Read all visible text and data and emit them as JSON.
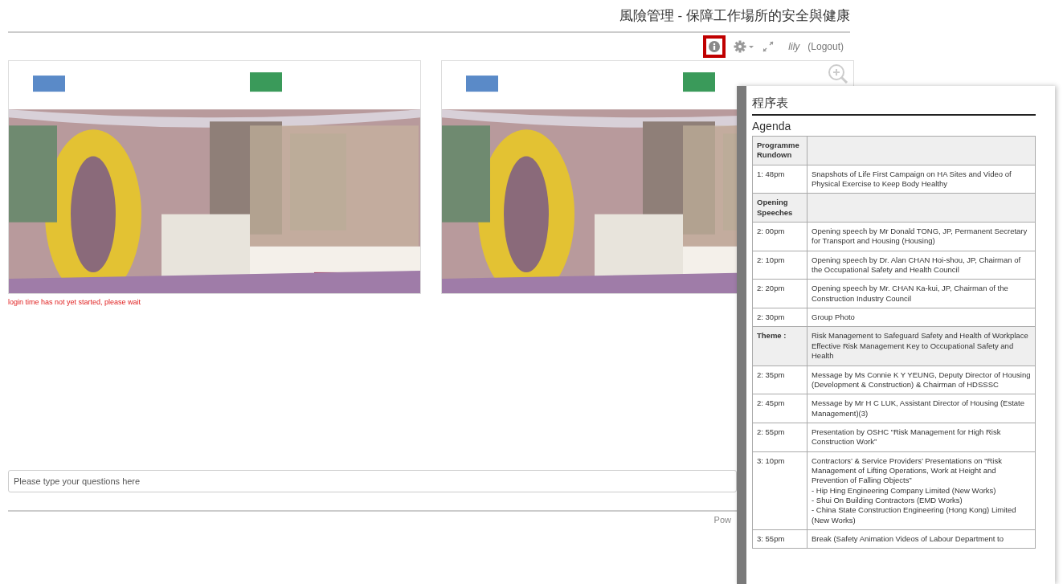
{
  "page_title": "風險管理 - 保障工作場所的安全與健康",
  "toolbar": {
    "info_highlighted": true,
    "user": "lily",
    "logout": "(Logout)"
  },
  "status_message": "login time has not yet started, please wait",
  "question_field": {
    "placeholder": "Please type your questions here"
  },
  "footer": "Pow",
  "agenda_panel": {
    "title": "程序表",
    "subtitle": "Agenda",
    "rows": [
      {
        "kind": "heading",
        "time": "Programme Rundown",
        "text": ""
      },
      {
        "kind": "item",
        "time": "1: 48pm",
        "text": "Snapshots of Life First Campaign on HA Sites and Video of Physical Exercise to Keep Body Healthy"
      },
      {
        "kind": "heading",
        "time": "Opening Speeches",
        "text": ""
      },
      {
        "kind": "item",
        "time": "2: 00pm",
        "text": "Opening speech by Mr Donald TONG, JP, Permanent Secretary for Transport and Housing (Housing)"
      },
      {
        "kind": "item",
        "time": "2: 10pm",
        "text": "Opening speech by Dr. Alan CHAN Hoi-shou, JP, Chairman of the Occupational Safety and Health Council"
      },
      {
        "kind": "item",
        "time": "2: 20pm",
        "text": "Opening speech by Mr. CHAN Ka-kui, JP, Chairman of the Construction Industry Council"
      },
      {
        "kind": "item",
        "time": "2: 30pm",
        "text": "Group Photo"
      },
      {
        "kind": "heading",
        "time": "Theme :",
        "text": "Risk Management to Safeguard Safety and Health of Workplace\nEffective Risk Management Key to Occupational Safety and Health"
      },
      {
        "kind": "item",
        "time": "2: 35pm",
        "text": "Message by Ms Connie K Y YEUNG, Deputy Director of Housing (Development & Construction) & Chairman of HDSSSC"
      },
      {
        "kind": "item",
        "time": "2: 45pm",
        "text": "Message by Mr H C LUK, Assistant Director of Housing (Estate Management)(3)"
      },
      {
        "kind": "item",
        "time": "2: 55pm",
        "text": "Presentation by OSHC “Risk Management for High Risk Construction Work”"
      },
      {
        "kind": "item",
        "time": "3: 10pm",
        "text": "Contractors’ & Service Providers’ Presentations on “Risk Management of Lifting Operations, Work at Height and Prevention of Falling Objects”\n- Hip Hing Engineering Company Limited (New Works)\n- Shui On Building Contractors (EMD Works)\n- China State Construction Engineering (Hong Kong) Limited (New Works)"
      },
      {
        "kind": "item",
        "time": "3: 55pm",
        "text": "Break  (Safety Animation Videos of Labour Department to"
      }
    ]
  }
}
